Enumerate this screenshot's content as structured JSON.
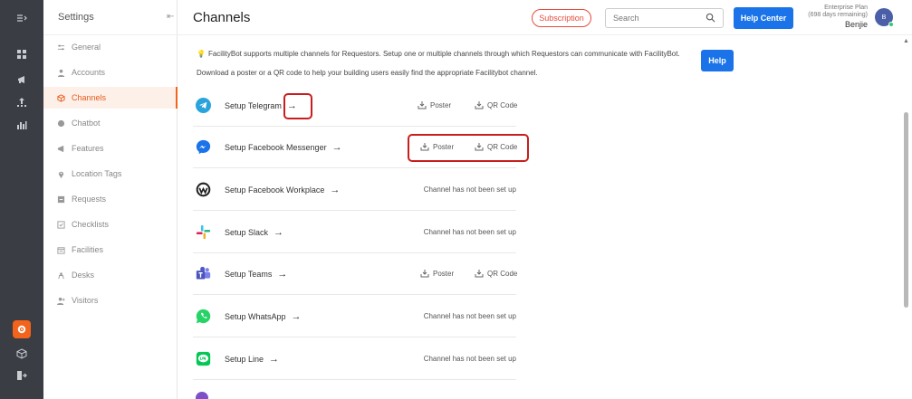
{
  "sidebar": {
    "header": "Settings",
    "collapse_icon": "collapse-icon",
    "items": [
      {
        "label": "General",
        "icon": "sliders-icon"
      },
      {
        "label": "Accounts",
        "icon": "user-icon"
      },
      {
        "label": "Channels",
        "icon": "channels-icon",
        "active": true
      },
      {
        "label": "Chatbot",
        "icon": "chat-icon"
      },
      {
        "label": "Features",
        "icon": "megaphone-icon"
      },
      {
        "label": "Location Tags",
        "icon": "pin-icon"
      },
      {
        "label": "Requests",
        "icon": "request-icon"
      },
      {
        "label": "Checklists",
        "icon": "checklist-icon"
      },
      {
        "label": "Facilities",
        "icon": "calendar-icon"
      },
      {
        "label": "Desks",
        "icon": "desk-icon"
      },
      {
        "label": "Visitors",
        "icon": "visitor-icon"
      }
    ]
  },
  "header": {
    "title": "Channels",
    "subscription_label": "Subscription",
    "search_placeholder": "Search",
    "help_center_label": "Help Center",
    "plan_name": "Enterprise Plan",
    "plan_remaining": "(698 days remaining)",
    "user_name": "Benjie",
    "avatar_initial": "B"
  },
  "info": {
    "line1": "FacilityBot supports multiple channels for Requestors. Setup one or multiple channels through which Requestors can communicate with FacilityBot.",
    "line2": "Download a poster or a QR code to help your building users easily find the appropriate Facilitybot channel.",
    "help_label": "Help"
  },
  "channels": [
    {
      "name": "Setup Telegram",
      "poster": "Poster",
      "qr": "QR Code",
      "status": ""
    },
    {
      "name": "Setup Facebook Messenger",
      "poster": "Poster",
      "qr": "QR Code",
      "status": ""
    },
    {
      "name": "Setup Facebook Workplace",
      "poster": "",
      "qr": "",
      "status": "Channel has not been set up"
    },
    {
      "name": "Setup Slack",
      "poster": "",
      "qr": "",
      "status": "Channel has not been set up"
    },
    {
      "name": "Setup Teams",
      "poster": "Poster",
      "qr": "QR Code",
      "status": ""
    },
    {
      "name": "Setup WhatsApp",
      "poster": "",
      "qr": "",
      "status": "Channel has not been set up"
    },
    {
      "name": "Setup Line",
      "poster": "",
      "qr": "",
      "status": "Channel has not been set up"
    }
  ],
  "colors": {
    "accent": "#f2631c",
    "primary": "#1a73e8",
    "highlight": "#c81e1e",
    "rail": "#3a3d44"
  }
}
